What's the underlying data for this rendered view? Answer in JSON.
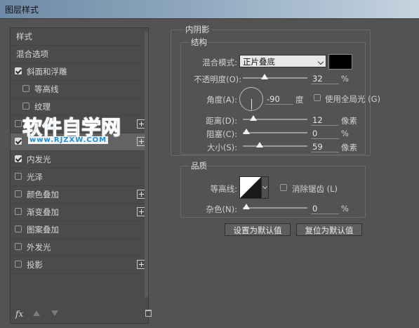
{
  "window": {
    "title": "图层样式"
  },
  "left_panel": {
    "items": [
      {
        "label": "样式",
        "checkbox": null,
        "indent": 0,
        "plus": false,
        "selected": false
      },
      {
        "label": "混合选项",
        "checkbox": null,
        "indent": 0,
        "plus": false,
        "selected": false
      },
      {
        "label": "斜面和浮雕",
        "checkbox": true,
        "indent": 0,
        "plus": false,
        "selected": false
      },
      {
        "label": "等高线",
        "checkbox": false,
        "indent": 1,
        "plus": false,
        "selected": false
      },
      {
        "label": "纹理",
        "checkbox": false,
        "indent": 1,
        "plus": false,
        "selected": false
      },
      {
        "label": "",
        "checkbox": false,
        "indent": 0,
        "plus": true,
        "selected": false
      },
      {
        "label": "",
        "checkbox": true,
        "indent": 0,
        "plus": true,
        "selected": true
      },
      {
        "label": "内发光",
        "checkbox": true,
        "indent": 0,
        "plus": false,
        "selected": false
      },
      {
        "label": "光泽",
        "checkbox": false,
        "indent": 0,
        "plus": false,
        "selected": false
      },
      {
        "label": "颜色叠加",
        "checkbox": false,
        "indent": 0,
        "plus": true,
        "selected": false
      },
      {
        "label": "渐变叠加",
        "checkbox": false,
        "indent": 0,
        "plus": true,
        "selected": false
      },
      {
        "label": "图案叠加",
        "checkbox": false,
        "indent": 0,
        "plus": false,
        "selected": false
      },
      {
        "label": "外发光",
        "checkbox": false,
        "indent": 0,
        "plus": false,
        "selected": false
      },
      {
        "label": "投影",
        "checkbox": false,
        "indent": 0,
        "plus": true,
        "selected": false
      }
    ],
    "bottom": {
      "fx_label": "fx"
    }
  },
  "watermark": {
    "main": "软件自学网",
    "sub": "www.RJZXW.COM"
  },
  "inner_shadow": {
    "section_title": "内阴影",
    "structure": {
      "title": "结构",
      "blend_mode_label": "混合模式:",
      "blend_mode_value": "正片叠底",
      "swatch_color": "#000000",
      "opacity_label": "不透明度(O):",
      "opacity_value": "32",
      "opacity_unit": "%",
      "angle_label": "角度(A):",
      "angle_value": "-90",
      "angle_unit": "度",
      "global_light_label": "使用全局光 (G)",
      "global_light_checked": false,
      "distance_label": "距离(D):",
      "distance_value": "12",
      "distance_unit": "像素",
      "choke_label": "阻塞(C):",
      "choke_value": "0",
      "choke_unit": "%",
      "size_label": "大小(S):",
      "size_value": "59",
      "size_unit": "像素"
    },
    "quality": {
      "title": "品质",
      "contour_label": "等高线:",
      "antialias_label": "消除锯齿 (L)",
      "antialias_checked": false,
      "noise_label": "杂色(N):",
      "noise_value": "0",
      "noise_unit": "%"
    },
    "buttons": {
      "set_default": "设置为默认值",
      "reset_default": "复位为默认值"
    }
  }
}
